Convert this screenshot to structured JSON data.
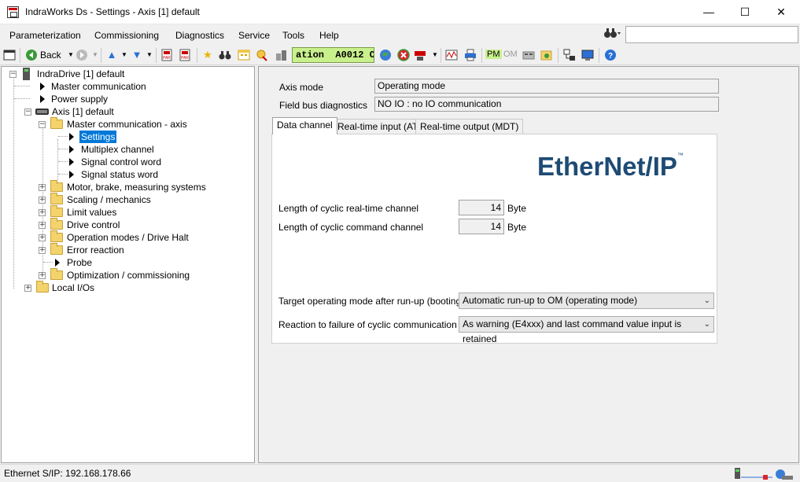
{
  "window": {
    "title": "IndraWorks Ds - Settings - Axis [1] default",
    "minimize": "—",
    "maximize": "☐",
    "close": "✕"
  },
  "menu": [
    "Parameterization",
    "Commissioning",
    "Diagnostics",
    "Service",
    "Tools",
    "Help"
  ],
  "search": {
    "value": "",
    "placeholder": ""
  },
  "toolbar": {
    "back_label": "Back",
    "lcd_display": "ation  A0012 C",
    "pm_label": "PM",
    "om_label": "OM"
  },
  "tree": {
    "root": "IndraDrive [1] default",
    "items": [
      "Master communication",
      "Power supply",
      "Axis [1] default",
      "Master communication - axis",
      "Settings",
      "Multiplex channel",
      "Signal control word",
      "Signal status word",
      "Motor, brake, measuring systems",
      "Scaling / mechanics",
      "Limit values",
      "Drive control",
      "Operation modes / Drive Halt",
      "Error reaction",
      "Probe",
      "Optimization / commissioning",
      "Local I/Os"
    ]
  },
  "content": {
    "axis_mode_label": "Axis mode",
    "axis_mode_value": "Operating mode",
    "fieldbus_label": "Field bus diagnostics",
    "fieldbus_value": "NO IO : no IO communication",
    "tabs": [
      "Data channel",
      "Real-time input (AT)",
      "Real-time output (MDT)"
    ],
    "logo_text": "EtherNet/IP",
    "logo_tm": "™",
    "rt_channel_label": "Length of cyclic real-time channel",
    "rt_channel_value": "14",
    "cmd_channel_label": "Length of cyclic command channel",
    "cmd_channel_value": "14",
    "unit": "Byte",
    "target_mode_label": "Target operating mode after run-up (booting)",
    "target_mode_value": "Automatic run-up to OM (operating mode)",
    "reaction_label": "Reaction to failure of cyclic communication",
    "reaction_value": "As warning (E4xxx) and last command value input is retained"
  },
  "status": {
    "text": "Ethernet S/IP: 192.168.178.66"
  },
  "icons": [
    "save-icon",
    "back-icon",
    "forward-icon",
    "up-icon",
    "down-icon",
    "par-icon",
    "favorite-icon",
    "binoculars-icon",
    "help-icon"
  ]
}
